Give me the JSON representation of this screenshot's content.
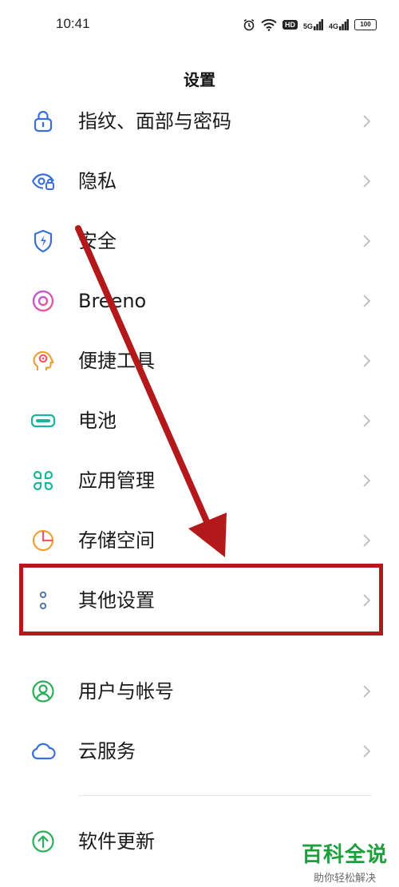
{
  "status_bar": {
    "time": "10:41",
    "signal_1": "5G",
    "signal_2": "4G",
    "hd": "HD",
    "battery": "100"
  },
  "header": {
    "title": "设置"
  },
  "items": [
    {
      "label": "指纹、面部与密码",
      "icon": "lock-icon",
      "color": "#3a6fd8"
    },
    {
      "label": "隐私",
      "icon": "privacy-eye-icon",
      "color": "#3a6fd8"
    },
    {
      "label": "安全",
      "icon": "shield-icon",
      "color": "#3a6fd8"
    },
    {
      "label": "Breeno",
      "icon": "breeno-ring-icon",
      "color": "#d94fa8"
    },
    {
      "label": "便捷工具",
      "icon": "tools-head-icon",
      "color": "#f0a030"
    },
    {
      "label": "电池",
      "icon": "battery-icon",
      "color": "#1bb59a"
    },
    {
      "label": "应用管理",
      "icon": "apps-grid-icon",
      "color": "#1bb59a"
    },
    {
      "label": "存储空间",
      "icon": "storage-pie-icon",
      "color": "#f0a030"
    },
    {
      "label": "其他设置",
      "icon": "more-dots-icon",
      "color": "#5a78a8"
    },
    {
      "label": "用户与帐号",
      "icon": "user-icon",
      "color": "#2eae5a"
    },
    {
      "label": "云服务",
      "icon": "cloud-icon",
      "color": "#3a6fd8"
    },
    {
      "label": "软件更新",
      "icon": "update-arrow-icon",
      "color": "#2eae5a"
    }
  ],
  "annotation": {
    "color": "#b3191b"
  },
  "watermark": {
    "title": "百科全说",
    "subtitle": "助你轻松解决",
    "color": "#1f9e3c"
  }
}
